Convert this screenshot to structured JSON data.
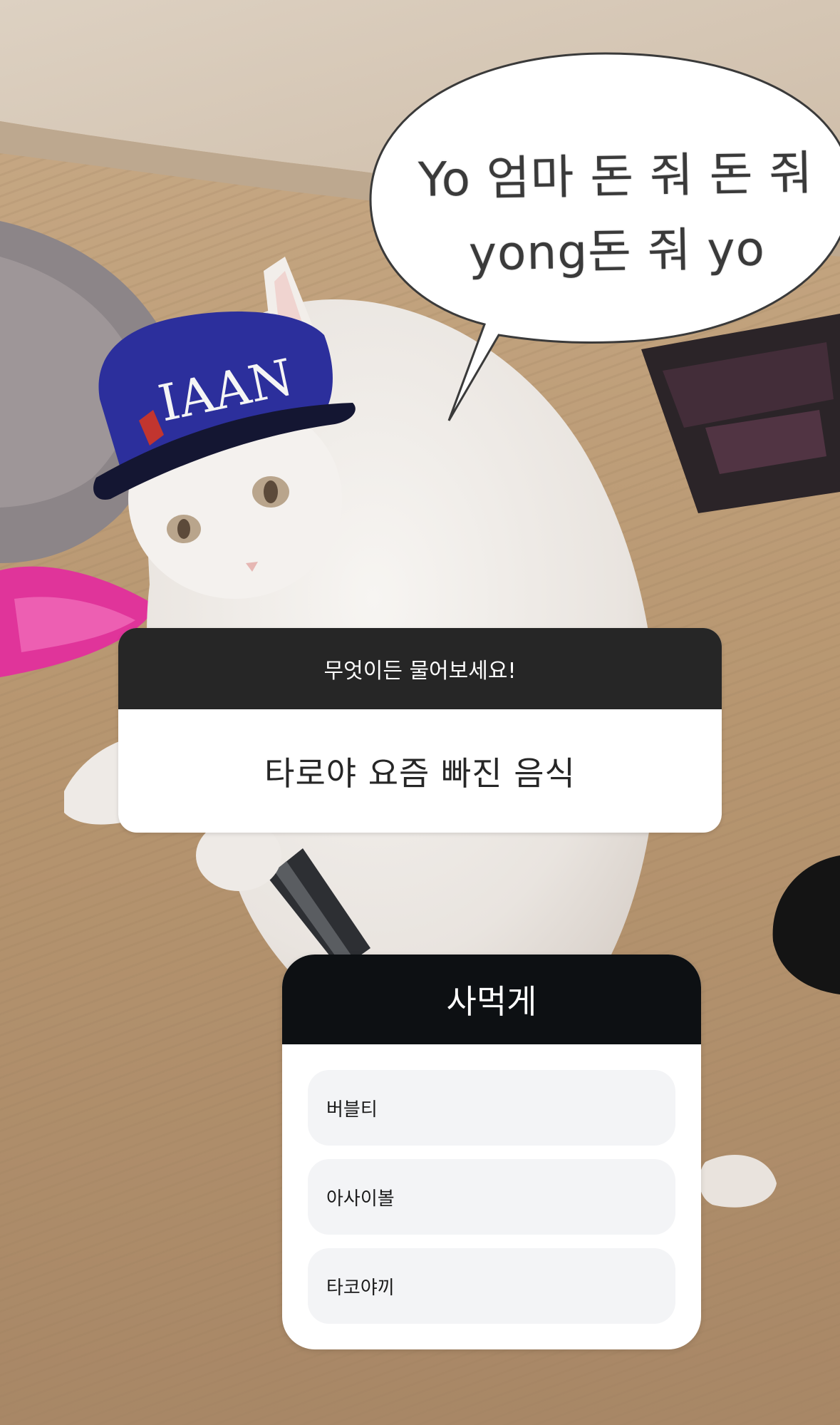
{
  "background": {
    "speech_bubble": {
      "line1": "Yo 엄마 돈 줘 돈 줘",
      "line2": "yong돈 줘 yo"
    },
    "cap_logo": "IAAN"
  },
  "question_sticker": {
    "prompt": "무엇이든 물어보세요!",
    "answer": "타로야 요즘 빠진 음식"
  },
  "poll_sticker": {
    "title": "사먹게",
    "options": [
      {
        "label": "버블티"
      },
      {
        "label": "아사이볼"
      },
      {
        "label": "타코야끼"
      }
    ]
  },
  "colors": {
    "question_header_bg": "#262626",
    "poll_header_bg": "#0d1013",
    "option_bg": "#f3f4f6"
  }
}
